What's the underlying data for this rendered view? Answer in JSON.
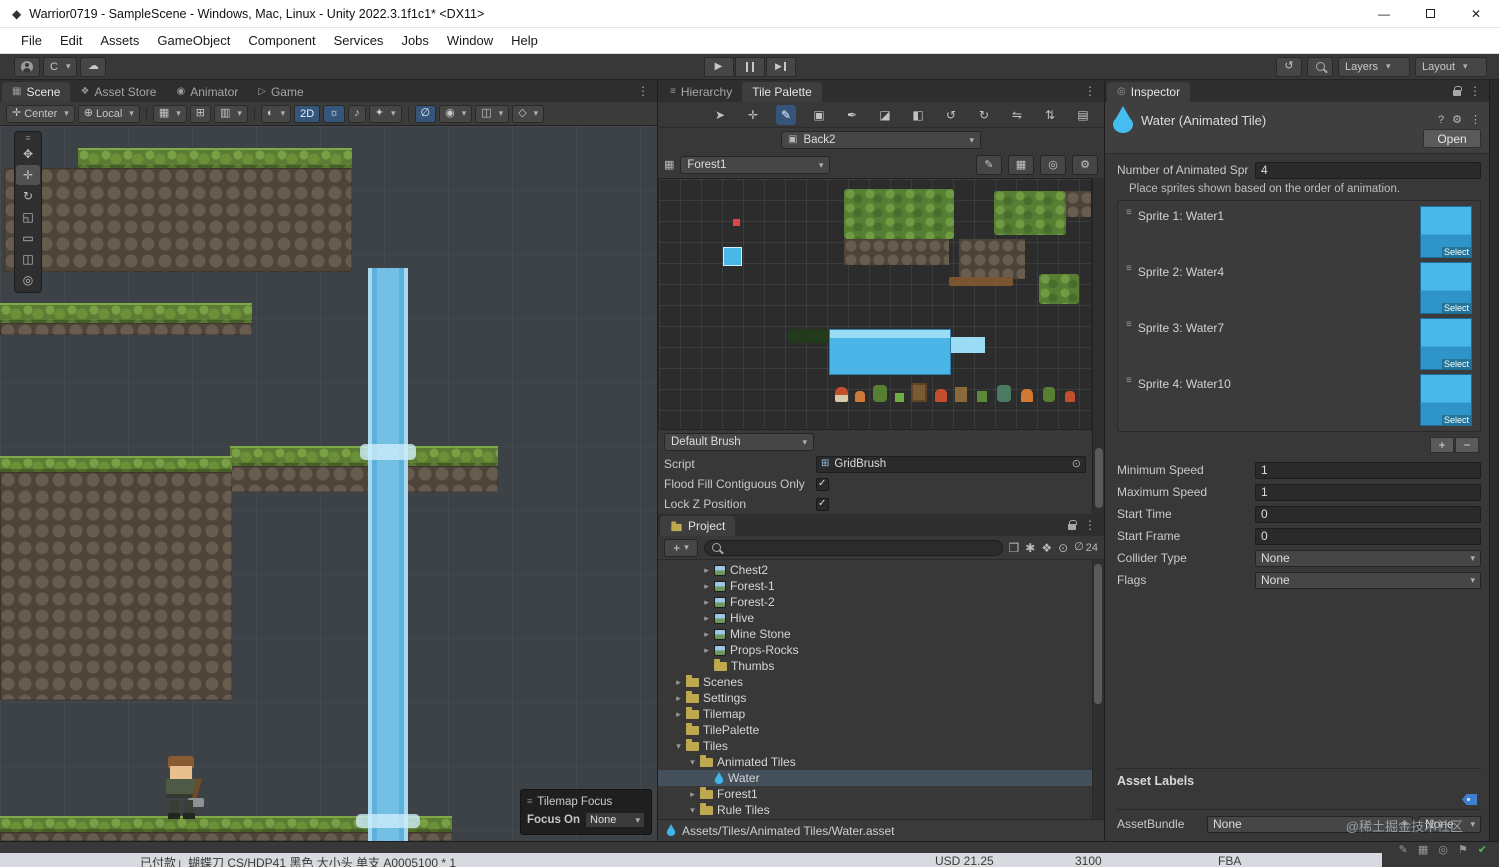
{
  "window": {
    "title": "Warrior0719 - SampleScene - Windows, Mac, Linux - Unity 2022.3.1f1c1* <DX11>",
    "minimize": "—",
    "maximize": "□",
    "close": "✕"
  },
  "menubar": {
    "items": [
      "File",
      "Edit",
      "Assets",
      "GameObject",
      "Component",
      "Services",
      "Jobs",
      "Window",
      "Help"
    ]
  },
  "toolbar": {
    "account_initial": "C",
    "layers": "Layers",
    "layout": "Layout"
  },
  "scene_panel": {
    "tabs": [
      "Scene",
      "Asset Store",
      "Animator",
      "Game"
    ],
    "handle_position": "Center",
    "coord_space": "Local",
    "mode_2d": "2D",
    "focus_overlay": {
      "title": "Tilemap Focus",
      "label": "Focus On",
      "value": "None"
    }
  },
  "tile_palette": {
    "tab_hierarchy": "Hierarchy",
    "tab_tile_palette": "Tile Palette",
    "active_target": "Back2",
    "palette_name": "Forest1",
    "brush_name": "Default Brush",
    "script_label": "Script",
    "script_value": "GridBrush",
    "option1": {
      "label": "Flood Fill Contiguous Only",
      "checked": true
    },
    "option2": {
      "label": "Lock Z Position",
      "checked": true
    }
  },
  "project": {
    "tab": "Project",
    "add_label": "+",
    "hidden_count": "24",
    "tree": [
      {
        "label": "Chest2"
      },
      {
        "label": "Forest-1"
      },
      {
        "label": "Forest-2"
      },
      {
        "label": "Hive"
      },
      {
        "label": "Mine Stone"
      },
      {
        "label": "Props-Rocks"
      },
      {
        "label": "Thumbs"
      },
      {
        "label": "Scenes"
      },
      {
        "label": "Settings"
      },
      {
        "label": "Tilemap"
      },
      {
        "label": "TilePalette"
      },
      {
        "label": "Tiles"
      },
      {
        "label": "Animated Tiles"
      },
      {
        "label": "Water"
      },
      {
        "label": "Forest1"
      },
      {
        "label": "Rule Tiles"
      }
    ],
    "selected_asset_path": "Assets/Tiles/Animated Tiles/Water.asset"
  },
  "inspector": {
    "tab": "Inspector",
    "title": "Water (Animated Tile)",
    "open_button": "Open",
    "count_field": {
      "label": "Number of Animated Spr",
      "value": "4"
    },
    "hint": "Place sprites shown based on the order of animation.",
    "sprites": [
      {
        "label": "Sprite 1: Water1",
        "select": "Select"
      },
      {
        "label": "Sprite 2: Water4",
        "select": "Select"
      },
      {
        "label": "Sprite 3: Water7",
        "select": "Select"
      },
      {
        "label": "Sprite 4: Water10",
        "select": "Select"
      }
    ],
    "add_button": "+",
    "remove_button": "−",
    "fields": [
      {
        "label": "Minimum Speed",
        "value": "1"
      },
      {
        "label": "Maximum Speed",
        "value": "1"
      },
      {
        "label": "Start Time",
        "value": "0"
      },
      {
        "label": "Start Frame",
        "value": "0"
      },
      {
        "label": "Collider Type",
        "value": "None"
      },
      {
        "label": "Flags",
        "value": "None"
      }
    ],
    "asset_labels_title": "Asset Labels",
    "assetbundle_label": "AssetBundle",
    "assetbundle_value": "None",
    "assetbundle_variant": "None"
  },
  "statusbar": {
    "watermark": "@稀土掘金技术社区",
    "order_text": "已付款」蝴蝶刀 CS/HDP41 黑色 大小头 单支 A0005100 * 1",
    "price": "USD 21.25",
    "quantity": "3100",
    "shipping": "FBA"
  },
  "colors": {
    "selection": "#44505c",
    "water_accent": "#49b9ea",
    "tool_active": "#35557a",
    "tag_blue": "#3f7fd2",
    "status_check_green": "#58b858"
  }
}
